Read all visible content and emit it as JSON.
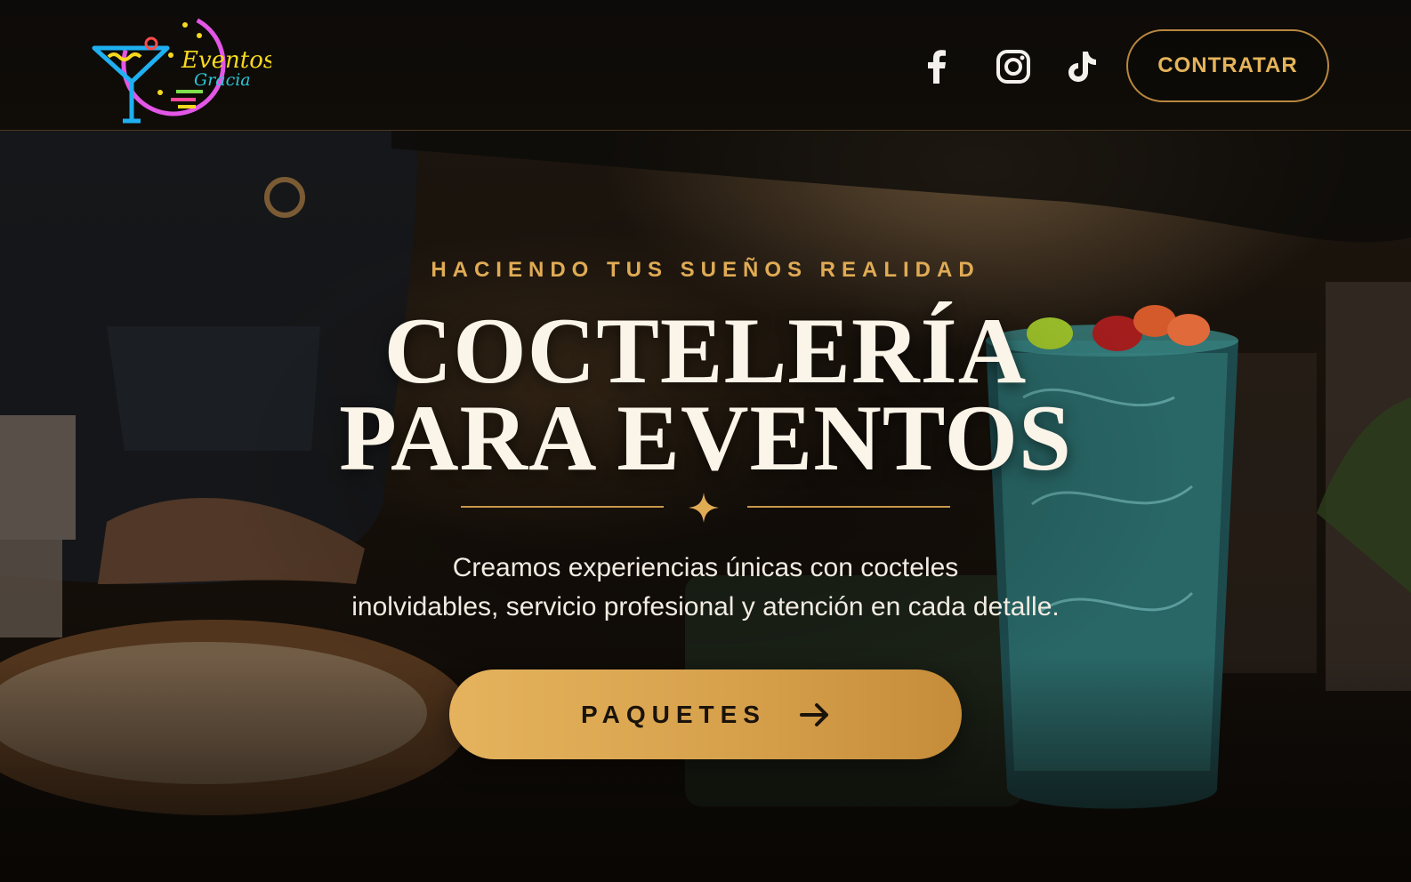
{
  "header": {
    "logo": {
      "text_line1": "Eventos",
      "text_line2": "Gracia"
    },
    "social": [
      {
        "name": "facebook-icon"
      },
      {
        "name": "instagram-icon"
      },
      {
        "name": "tiktok-icon"
      }
    ],
    "cta_label": "CONTRATAR"
  },
  "hero": {
    "tagline": "HACIENDO TUS SUEÑOS REALIDAD",
    "title_line1": "COCTELERÍA",
    "title_line2": "PARA EVENTOS",
    "subtitle_line1": "Creamos experiencias únicas con cocteles",
    "subtitle_line2": "inolvidables, servicio profesional y atención en cada detalle.",
    "cta_label": "PAQUETES",
    "cta_icon": "arrow-right-icon",
    "divider_icon": "sparkle-icon"
  },
  "colors": {
    "accent_gold": "#e0ab55",
    "button_gold": "#d7a14c",
    "header_bg": "#0d0b09",
    "title_text": "#fbf4e8"
  }
}
